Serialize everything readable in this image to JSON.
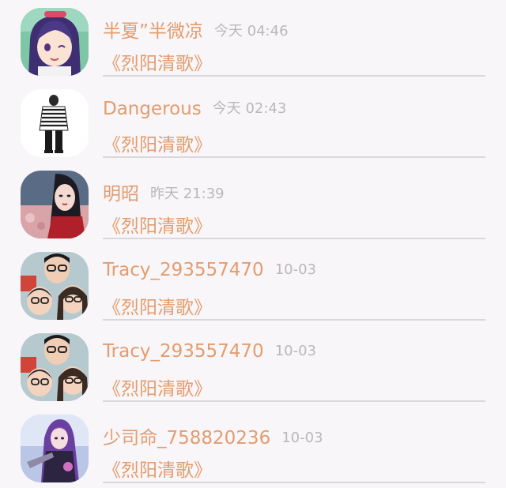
{
  "colors": {
    "accent": "#e39c6e",
    "muted": "#b9b9b9",
    "background": "#f8f6f8",
    "divider": "#d9d7d9"
  },
  "items": [
    {
      "name": "半夏”半微凉",
      "time": "今天 04:46",
      "title": "《烈阳清歌》",
      "avatar": "anime-girl-avatar"
    },
    {
      "name": "Dangerous",
      "time": "今天 02:43",
      "title": "《烈阳清歌》",
      "avatar": "striped-shirt-avatar"
    },
    {
      "name": "明昭",
      "time": "昨天 21:39",
      "title": "《烈阳清歌》",
      "avatar": "costume-woman-avatar"
    },
    {
      "name": "Tracy_293557470",
      "time": "10-03",
      "title": "《烈阳清歌》",
      "avatar": "family-photo-avatar"
    },
    {
      "name": "Tracy_293557470",
      "time": "10-03",
      "title": "《烈阳清歌》",
      "avatar": "family-photo-avatar"
    },
    {
      "name": "少司命_758820236",
      "time": "10-03",
      "title": "《烈阳清歌》",
      "avatar": "game-character-avatar"
    }
  ]
}
